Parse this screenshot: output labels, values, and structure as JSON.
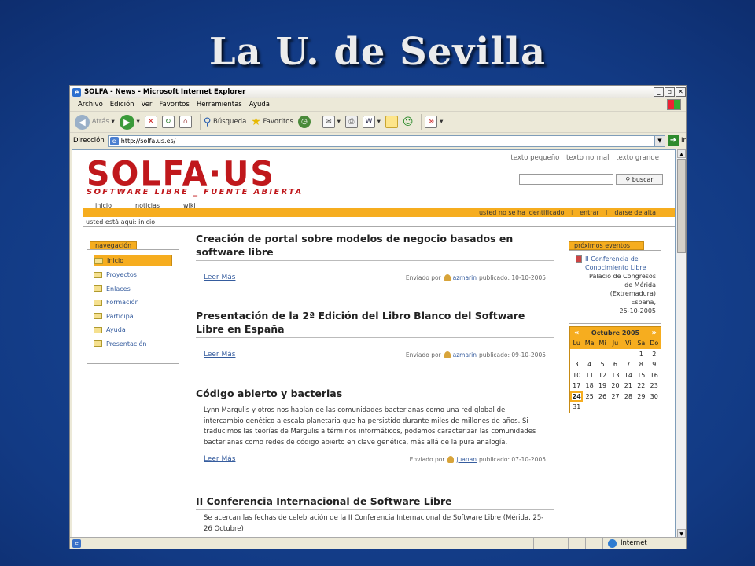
{
  "slide": {
    "title": "La U. de Sevilla"
  },
  "browser": {
    "window_title": "SOLFA - News - Microsoft Internet Explorer",
    "menus": [
      "Archivo",
      "Edición",
      "Ver",
      "Favoritos",
      "Herramientas",
      "Ayuda"
    ],
    "toolbar": {
      "back": "Atrás",
      "search": "Búsqueda",
      "favorites": "Favoritos"
    },
    "address_label": "Dirección",
    "url": "http://solfa.us.es/",
    "go_label": "Ir",
    "status_zone": "Internet"
  },
  "site": {
    "logo_main": "SOLFA·US",
    "logo_sub": "SOFTWARE LIBRE _ FUENTE ABIERTA",
    "text_sizes": [
      "texto pequeño",
      "texto normal",
      "texto grande"
    ],
    "search_button": "buscar",
    "tabs": [
      "inicio",
      "noticias",
      "wiki"
    ],
    "user_bar": {
      "status": "usted no se ha identificado",
      "login": "entrar",
      "register": "darse de alta"
    },
    "breadcrumb": "usted está aquí: inicio",
    "nav": {
      "title": "navegación",
      "items": [
        "Inicio",
        "Proyectos",
        "Enlaces",
        "Formación",
        "Participa",
        "Ayuda",
        "Presentación"
      ]
    },
    "articles": [
      {
        "title": "Creación de portal sobre modelos de negocio basados en software libre",
        "body": "",
        "read_more": "Leer Más",
        "posted_by": "Enviado por",
        "user": "azmarin",
        "published": "publicado: 10-10-2005"
      },
      {
        "title": "Presentación de la 2ª Edición del Libro Blanco del Software Libre en España",
        "body": "",
        "read_more": "Leer Más",
        "posted_by": "Enviado por",
        "user": "azmarin",
        "published": "publicado: 09-10-2005"
      },
      {
        "title": "Código abierto y bacterias",
        "body": "Lynn Margulis y otros nos hablan de las comunidades bacterianas como una red global de intercambio genético a escala planetaria que ha persistido durante miles de millones de años. Si traducimos las teorías de Margulis a términos informáticos, podemos caracterizar las comunidades bacterianas como redes de código abierto en clave genética, más allá de la pura analogía.",
        "read_more": "Leer Más",
        "posted_by": "Enviado por",
        "user": "juanan",
        "published": "publicado: 07-10-2005"
      },
      {
        "title": "II Conferencia Internacional de Software Libre",
        "body": "Se acercan las fechas de celebración de la II Conferencia Internacional de Software Libre (Mérida, 25-26 Octubre)",
        "read_more": "",
        "posted_by": "",
        "user": "",
        "published": ""
      }
    ],
    "events": {
      "title": "próximos eventos",
      "link": "II Conferencia de Conocimiento Libre",
      "address_lines": [
        "Palacio de Congresos",
        "de Mérida",
        "(Extremadura)",
        "España,",
        "25-10-2005"
      ]
    },
    "calendar": {
      "prev": "«",
      "next": "»",
      "month": "Octubre 2005",
      "days": [
        "Lu",
        "Ma",
        "Mi",
        "Ju",
        "Vi",
        "Sa",
        "Do"
      ],
      "weeks": [
        [
          "",
          "",
          "",
          "",
          "",
          "1",
          "2"
        ],
        [
          "3",
          "4",
          "5",
          "6",
          "7",
          "8",
          "9"
        ],
        [
          "10",
          "11",
          "12",
          "13",
          "14",
          "15",
          "16"
        ],
        [
          "17",
          "18",
          "19",
          "20",
          "21",
          "22",
          "23"
        ],
        [
          "24",
          "25",
          "26",
          "27",
          "28",
          "29",
          "30"
        ],
        [
          "31",
          "",
          "",
          "",
          "",
          "",
          ""
        ]
      ],
      "today": "24"
    }
  }
}
